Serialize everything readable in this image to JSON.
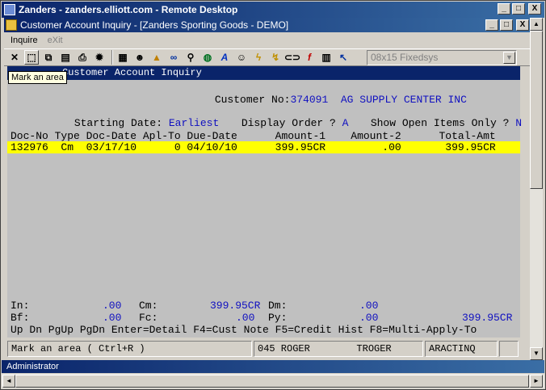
{
  "rd_window": {
    "title": "Zanders - zanders.elliott.com - Remote Desktop",
    "min": "_",
    "max": "□",
    "close": "X"
  },
  "app_window": {
    "title": "Customer Account Inquiry - [Zanders Sporting Goods - DEMO]",
    "min": "_",
    "max": "□",
    "close": "X"
  },
  "menu": {
    "inquire": "Inquire",
    "exit": "eXit"
  },
  "toolbar": {
    "icons": [
      "close-x-icon",
      "mark-area-icon",
      "copy-icon",
      "paste-icon",
      "print-icon",
      "settings-icon",
      "notepad-icon",
      "person-icon",
      "alert-icon",
      "binoculars-icon",
      "magnifier-icon",
      "globe-icon",
      "italic-a-icon",
      "face-icon",
      "lightning-icon",
      "flash-icon",
      "link-icon",
      "function-icon",
      "calculator-icon",
      "help-arrow-icon"
    ],
    "font_combo": "08x15 Fixedsys",
    "font_arrow": "▼"
  },
  "tooltip": "Mark an area",
  "terminal": {
    "title": "Customer Account Inquiry",
    "customer_label": "Customer No:",
    "customer_no": "374091",
    "customer_name": "AG SUPPLY CENTER INC",
    "starting_label": "Starting Date:",
    "starting_value": "Earliest",
    "order_label": "Display Order ?",
    "order_value": "A",
    "open_label": "Show Open Items Only ?",
    "open_value": "N",
    "headers": "Doc-No Type Doc-Date Apl-To Due-Date      Amount-1    Amount-2      Total-Amt",
    "row": "132976  Cm  03/17/10      0 04/10/10      399.95CR         .00       399.95CR",
    "totals": {
      "in_label": "In:",
      "in_value": ".00",
      "cm_label": "Cm:",
      "cm_value": "399.95CR",
      "dm_label": "Dm:",
      "dm_value": ".00",
      "bf_label": "Bf:",
      "bf_value": ".00",
      "fc_label": "Fc:",
      "fc_value": ".00",
      "py_label": "Py:",
      "py_value": ".00",
      "total_value": "399.95CR"
    },
    "keys": "Up Dn PgUp PgDn Enter=Detail F4=Cust Note F5=Credit Hist F8=Multi-Apply-To"
  },
  "status": {
    "message": "Mark an area ( Ctrl+R )",
    "user": "045 ROGER        TROGER",
    "program": "ARACTINQ"
  },
  "rd_status": "Administrator",
  "scroll": {
    "up": "▲",
    "down": "▼",
    "left": "◄",
    "right": "►"
  }
}
